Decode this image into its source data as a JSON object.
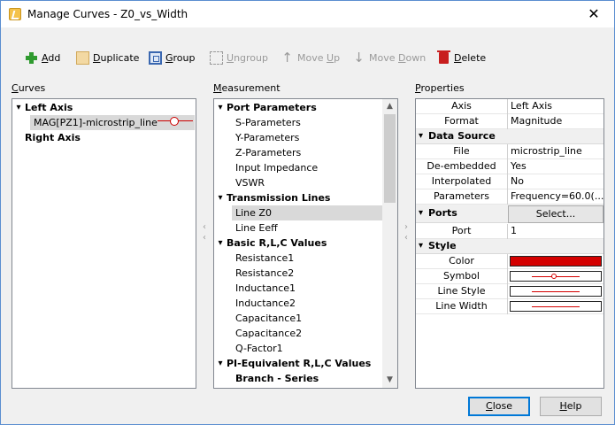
{
  "window": {
    "title": "Manage Curves - Z0_vs_Width",
    "close_glyph": "✕"
  },
  "toolbar": {
    "add_pre": "",
    "add_u": "A",
    "add_post": "dd",
    "duplicate_pre": "",
    "duplicate_u": "D",
    "duplicate_post": "uplicate",
    "group_pre": "",
    "group_u": "G",
    "group_post": "roup",
    "ungroup_pre": "",
    "ungroup_u": "U",
    "ungroup_post": "ngroup",
    "moveup_pre": "Move ",
    "moveup_u": "U",
    "moveup_post": "p",
    "movedown_pre": "Move ",
    "movedown_u": "D",
    "movedown_post": "own",
    "delete_pre": "",
    "delete_u": "D",
    "delete_post": "elete",
    "up_glyph": "↑",
    "down_glyph": "↓"
  },
  "labels": {
    "curves_u": "C",
    "curves_post": "urves",
    "measurement_pre": "",
    "measurement_u": "M",
    "measurement_post": "easurement",
    "properties_pre": "",
    "properties_u": "P",
    "properties_post": "roperties"
  },
  "curves": {
    "left_axis": "Left Axis",
    "curve": "MAG[PZ1]-microstrip_line",
    "right_axis": "Right Axis"
  },
  "measurement": {
    "items": [
      {
        "label": "Port Parameters",
        "level": 0
      },
      {
        "label": "S-Parameters",
        "level": 1
      },
      {
        "label": "Y-Parameters",
        "level": 1
      },
      {
        "label": "Z-Parameters",
        "level": 1
      },
      {
        "label": "Input Impedance",
        "level": 1
      },
      {
        "label": "VSWR",
        "level": 1
      },
      {
        "label": "Transmission Lines",
        "level": 0
      },
      {
        "label": "Line Z0",
        "level": 1
      },
      {
        "label": "Line Eeff",
        "level": 1
      },
      {
        "label": "Basic R,L,C Values",
        "level": 0
      },
      {
        "label": "Resistance1",
        "level": 1
      },
      {
        "label": "Resistance2",
        "level": 1
      },
      {
        "label": "Inductance1",
        "level": 1
      },
      {
        "label": "Inductance2",
        "level": 1
      },
      {
        "label": "Capacitance1",
        "level": 1
      },
      {
        "label": "Capacitance2",
        "level": 1
      },
      {
        "label": "Q-Factor1",
        "level": 1
      },
      {
        "label": "PI-Equivalent R,L,C Values",
        "level": 0
      },
      {
        "label": "Branch - Series",
        "level": 1
      }
    ],
    "selected": "Line Z0"
  },
  "properties": {
    "axis_name": "Axis",
    "axis_value": "Left Axis",
    "format_name": "Format",
    "format_value": "Magnitude",
    "cat_datasource": "Data Source",
    "file_name": "File",
    "file_value": "microstrip_line",
    "deembedded_name": "De-embedded",
    "deembedded_value": "Yes",
    "interpolated_name": "Interpolated",
    "interpolated_value": "No",
    "parameters_name": "Parameters",
    "parameters_value": "Frequency=60.0(...",
    "cat_ports": "Ports",
    "select_button": "Select...",
    "port_name": "Port",
    "port_value": "1",
    "cat_style": "Style",
    "color_name": "Color",
    "color_value": "#d40000",
    "symbol_name": "Symbol",
    "linestyle_name": "Line Style",
    "linewidth_name": "Line Width"
  },
  "buttons": {
    "close_pre": "",
    "close_u": "C",
    "close_post": "lose",
    "help_pre": "",
    "help_u": "H",
    "help_post": "elp"
  },
  "splitter": {
    "left_glyph": "‹",
    "right_glyph": "›"
  },
  "scroll": {
    "up": "▲",
    "down": "▼"
  },
  "tree": {
    "collapse": "▾"
  }
}
